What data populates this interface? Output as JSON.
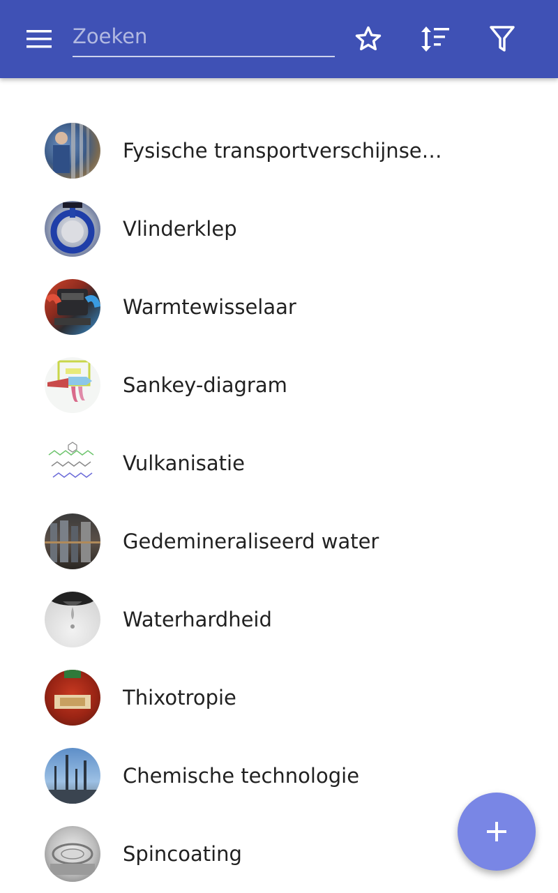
{
  "toolbar": {
    "background": "#3f51b5",
    "menu_icon": "hamburger-menu-icon",
    "search_placeholder": "Zoeken",
    "search_value": "",
    "favorites_icon": "star-outline-icon",
    "sort_icon": "sort-icon",
    "filter_icon": "filter-icon"
  },
  "items": [
    {
      "label": "Fysische transportverschijnse…",
      "thumbnail": "tube-worker-photo"
    },
    {
      "label": "Vlinderklep",
      "thumbnail": "butterfly-valve-photo"
    },
    {
      "label": "Warmtewisselaar",
      "thumbnail": "heat-exchanger-photo"
    },
    {
      "label": "Sankey-diagram",
      "thumbnail": "sankey-diagram-image"
    },
    {
      "label": "Vulkanisatie",
      "thumbnail": "molecule-structure-image"
    },
    {
      "label": "Gedemineraliseerd water",
      "thumbnail": "water-plant-photo"
    },
    {
      "label": "Waterhardheid",
      "thumbnail": "faucet-drip-photo"
    },
    {
      "label": "Thixotropie",
      "thumbnail": "ketchup-bottle-photo"
    },
    {
      "label": "Chemische technologie",
      "thumbnail": "chemical-plant-photo"
    },
    {
      "label": "Spincoating",
      "thumbnail": "spin-coater-photo"
    }
  ],
  "fab": {
    "icon": "plus-icon",
    "color": "#7986e5"
  }
}
